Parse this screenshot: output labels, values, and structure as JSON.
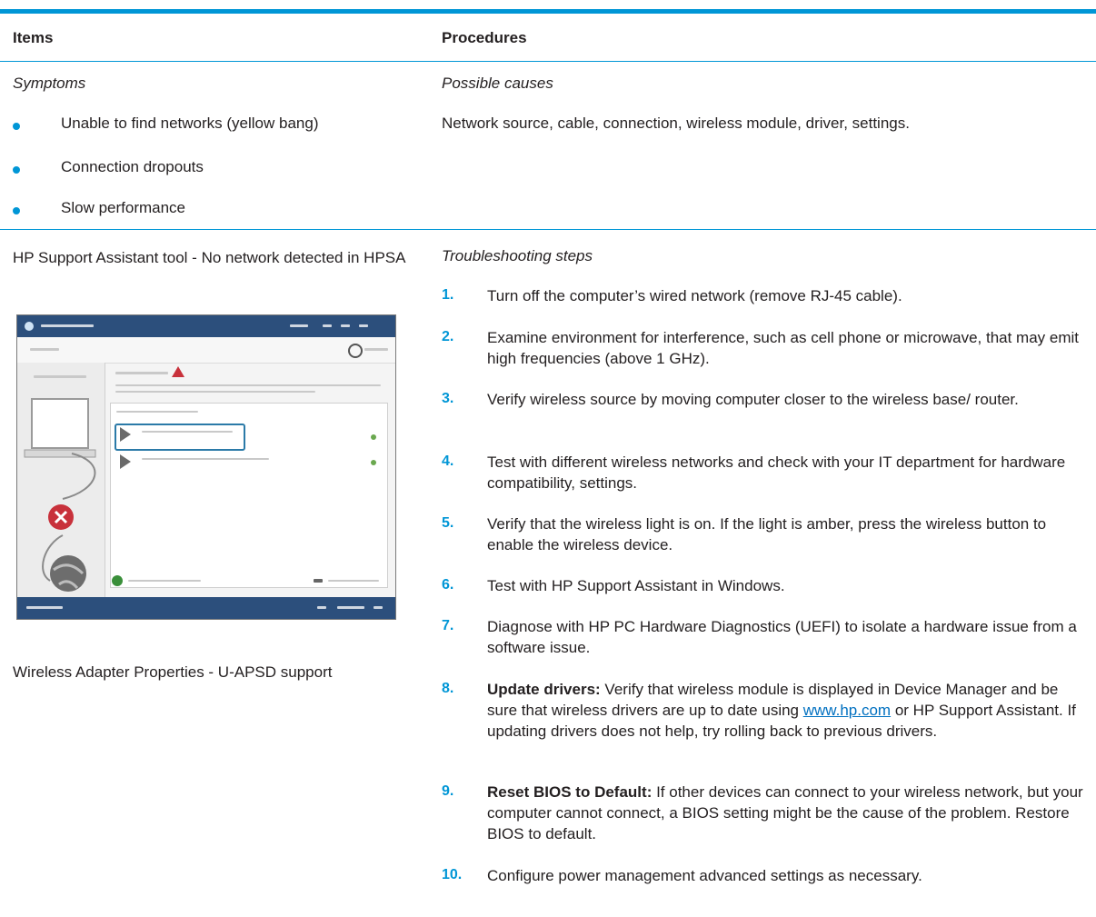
{
  "header": {
    "items": "Items",
    "procedures": "Procedures"
  },
  "symptoms": {
    "label": "Symptoms",
    "list": [
      "Unable to find networks (yellow bang)",
      "Connection dropouts",
      "Slow performance"
    ]
  },
  "causes": {
    "label": "Possible causes",
    "text": "Network source, cable, connection, wireless module, driver, settings."
  },
  "tools": {
    "hpsa": "HP Support Assistant tool - No network detected in HPSA",
    "adapter": "Wireless Adapter Properties - U-APSD support"
  },
  "troubleshooting": {
    "label": "Troubleshooting steps",
    "steps": [
      {
        "num": "1.",
        "text": "Turn off the computer’s wired network (remove RJ-45 cable)."
      },
      {
        "num": "2.",
        "text": "Examine environment for interference, such as cell phone or microwave, that may emit high frequencies (above 1 GHz)."
      },
      {
        "num": "3.",
        "text": "Verify wireless source by moving computer closer to the wireless base/ router."
      },
      {
        "num": "4.",
        "text": "Test with different wireless networks and check with your IT department for hardware compatibility, settings."
      },
      {
        "num": "5.",
        "text": "Verify that the wireless light is on. If the light is amber, press the wireless button to enable the wireless device."
      },
      {
        "num": "6.",
        "text": "Test with HP Support Assistant in Windows."
      },
      {
        "num": "7.",
        "text": "Diagnose with HP PC Hardware Diagnostics (UEFI) to isolate a hardware issue from a software issue."
      },
      {
        "num": "8.",
        "bold": "Update drivers:",
        "text_a": " Verify that wireless module is displayed in Device Manager and be sure that wireless drivers are up to date using ",
        "link": "www.hp.com",
        "text_b": " or HP Support Assistant. If updating drivers does not help, try rolling back to previous drivers."
      },
      {
        "num": "9.",
        "bold": "Reset BIOS to Default:",
        "text": " If other devices can connect to your wireless network, but your computer cannot connect, a BIOS setting might be the cause of the problem. Restore BIOS to default."
      },
      {
        "num": "10.",
        "text": "Configure power management advanced settings as necessary."
      }
    ]
  },
  "colors": {
    "accent": "#0096d6",
    "link": "#0070c0",
    "text": "#231f20"
  }
}
